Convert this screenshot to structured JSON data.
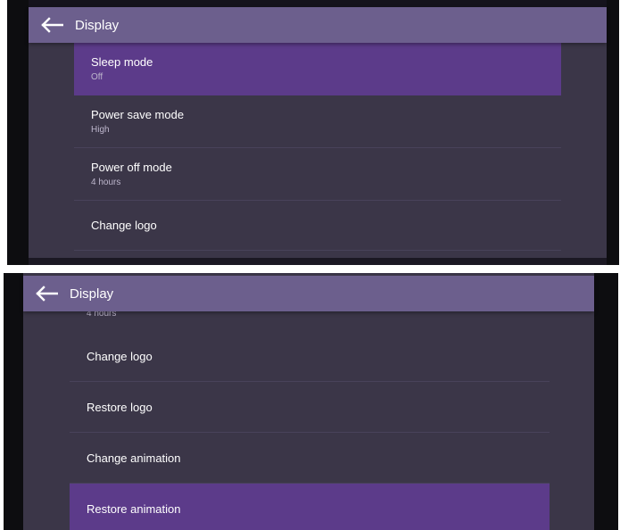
{
  "screen1": {
    "appbar": {
      "title": "Display"
    },
    "items": [
      {
        "label": "Sleep mode",
        "value": "Off",
        "selected": true
      },
      {
        "label": "Power save mode",
        "value": "High",
        "selected": false
      },
      {
        "label": "Power off mode",
        "value": "4 hours",
        "selected": false
      },
      {
        "label": "Change logo",
        "value": "",
        "selected": false
      }
    ]
  },
  "screen2": {
    "appbar": {
      "title": "Display"
    },
    "partial_value": "4 hours",
    "items": [
      {
        "label": "Change logo",
        "selected": false
      },
      {
        "label": "Restore logo",
        "selected": false
      },
      {
        "label": "Change animation",
        "selected": false
      },
      {
        "label": "Restore animation",
        "selected": true
      }
    ]
  },
  "colors": {
    "appbar": "#6c5f8d",
    "background": "#3b3648",
    "selected": "#5c3b8a"
  },
  "icons": {
    "back": "arrow-left-icon"
  }
}
